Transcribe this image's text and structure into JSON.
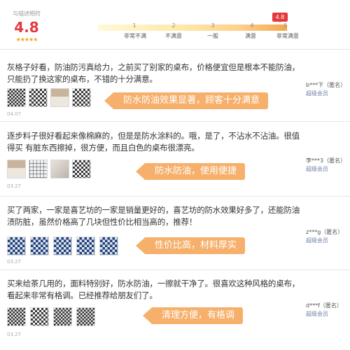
{
  "rating": {
    "caption": "与描述相符",
    "score": "4.8",
    "stars": "★★★★★"
  },
  "scale": {
    "marker": "4.8",
    "ticks": [
      "1",
      "2",
      "3",
      "4",
      "5"
    ],
    "labels": [
      "非常不满",
      "不满意",
      "一般",
      "满意",
      "非常满意"
    ],
    "marker_value": 4.8
  },
  "reviews": [
    {
      "text": "灰格子好看，防油防污真给力，之前买了别家的桌布，价格便宜但是根本不能防油，只能扔了换这家的桌布，不错的十分满意。",
      "user": "b***下（匿名）",
      "level": "超级会员",
      "date": "04.07",
      "tag": "防水防油效果显著，顾客十分满意",
      "thumbs": [
        "p-dark",
        "p-check",
        "p-room",
        "p-check"
      ]
    },
    {
      "text": "逐步料子很好看起来像棉麻的，但是是防水涂料的。哦，是了，不沾水不沾油。很值得买 有脏东西擦掉，很方便，而且白色的桌布很漂亮。",
      "user": "李***3（匿名）",
      "level": "超级会员",
      "date": "03.27",
      "tag": "防水防油，使用便捷",
      "thumbs": [
        "p-room",
        "p-grid",
        "p-cloth",
        "p-check"
      ]
    },
    {
      "text": "买了两家，一家是喜艺坊的一家是销量更好的，喜艺坊的防水效果好多了，还能防油渍防脏，虽然价格高了几块但性价比相当高的，推荐！",
      "user": "z***g（匿名）",
      "level": "超级会员",
      "date": "03.27",
      "tag": "性价比高，材料厚实",
      "thumbs": [
        "p-blue",
        "p-blue",
        "p-blue",
        "p-blue",
        "p-blue"
      ]
    },
    {
      "text": "买来给茶几用的，面料特别好，防水防油，一擦就干净了。很喜欢这种风格的桌布，看起来非常有格调。已经推荐给朋友们了。",
      "user": "d***f（匿名）",
      "level": "超级会员",
      "date": "03.27",
      "tag": "清理方便，有格调",
      "thumbs": [
        "p-dark",
        "p-check",
        "p-dark",
        "p-dark"
      ]
    }
  ]
}
